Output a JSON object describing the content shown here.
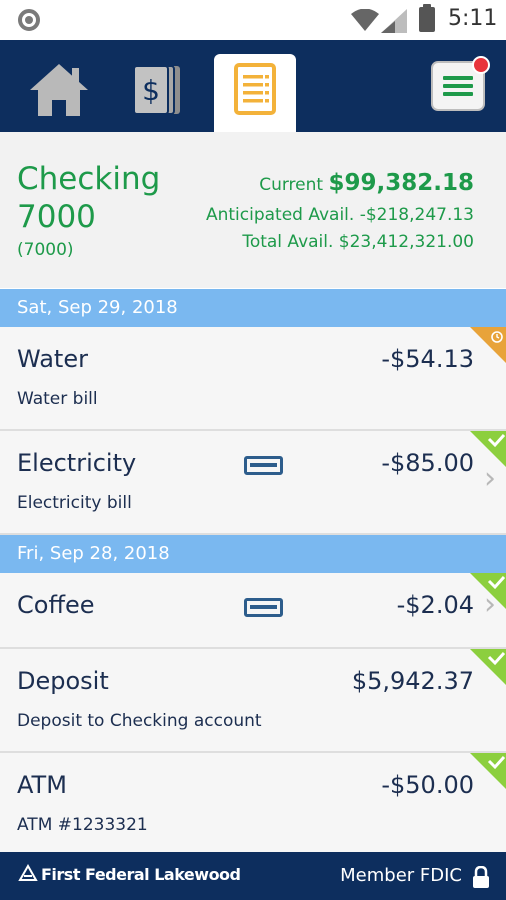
{
  "status_bar": {
    "time": "5:11"
  },
  "nav": {
    "tabs": [
      {
        "name": "home",
        "icon": "home-icon"
      },
      {
        "name": "accounts",
        "icon": "dollar-cards-icon"
      },
      {
        "name": "activity",
        "icon": "ledger-icon",
        "selected": true
      }
    ],
    "menu_icon": "menu-icon",
    "menu_has_notification": true
  },
  "account": {
    "name": "Checking 7000",
    "number": "(7000)",
    "current_label": "Current",
    "current_value": "$99,382.18",
    "anticipated": "Anticipated Avail. -$218,247.13",
    "total": "Total Avail. $23,412,321.00"
  },
  "groups": [
    {
      "date": "Sat, Sep 29, 2018",
      "transactions": [
        {
          "name": "Water",
          "desc": "Water bill",
          "amount": "-$54.13",
          "status": "pending"
        },
        {
          "name": "Electricity",
          "desc": "Electricity bill",
          "amount": "-$85.00",
          "status": "cleared",
          "card": true,
          "chevron": true
        }
      ]
    },
    {
      "date": "Fri, Sep 28, 2018",
      "transactions": [
        {
          "name": "Coffee",
          "desc": "",
          "amount": "-$2.04",
          "status": "cleared",
          "card": true,
          "chevron": true
        },
        {
          "name": "Deposit",
          "desc": "Deposit to Checking account",
          "amount": "$5,942.37",
          "status": "cleared"
        },
        {
          "name": "ATM",
          "desc": "ATM #1233321",
          "amount": "-$50.00",
          "status": "cleared"
        }
      ]
    }
  ],
  "footer": {
    "logo_text": "First Federal Lakewood",
    "fdic": "Member FDIC"
  },
  "colors": {
    "nav_bg": "#0d2e5e",
    "accent_green": "#1e9a4a",
    "date_header": "#7ab8f0",
    "pending_orange": "#e8a33a",
    "cleared_green": "#8ccf3e"
  }
}
